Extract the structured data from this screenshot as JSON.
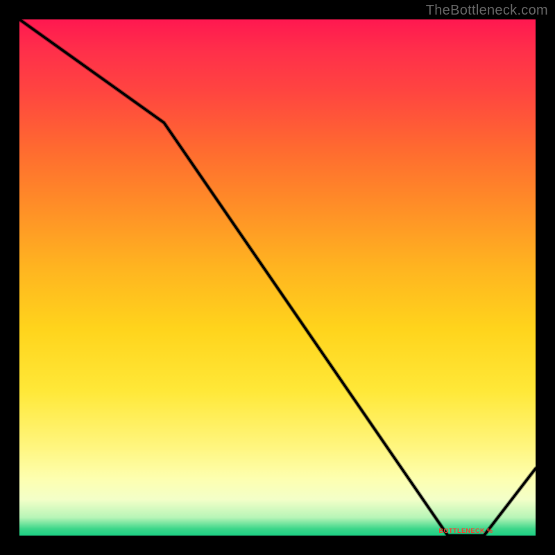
{
  "watermark": "TheBottleneck.com",
  "chart_data": {
    "type": "line",
    "title": "",
    "xlabel": "",
    "ylabel": "",
    "xlim": [
      0,
      100
    ],
    "ylim": [
      0,
      100
    ],
    "x": [
      0,
      28,
      83,
      90,
      100
    ],
    "values": [
      100,
      80,
      0,
      0,
      13
    ],
    "annotations": [
      {
        "text": "BOTTLENECK %",
        "x": 86.5,
        "y": 0
      }
    ]
  },
  "colors": {
    "line": "#000000",
    "line_shadow": "rgba(0,0,0,0.35)",
    "annotation": "#ff3a2e",
    "background": "#000000"
  }
}
